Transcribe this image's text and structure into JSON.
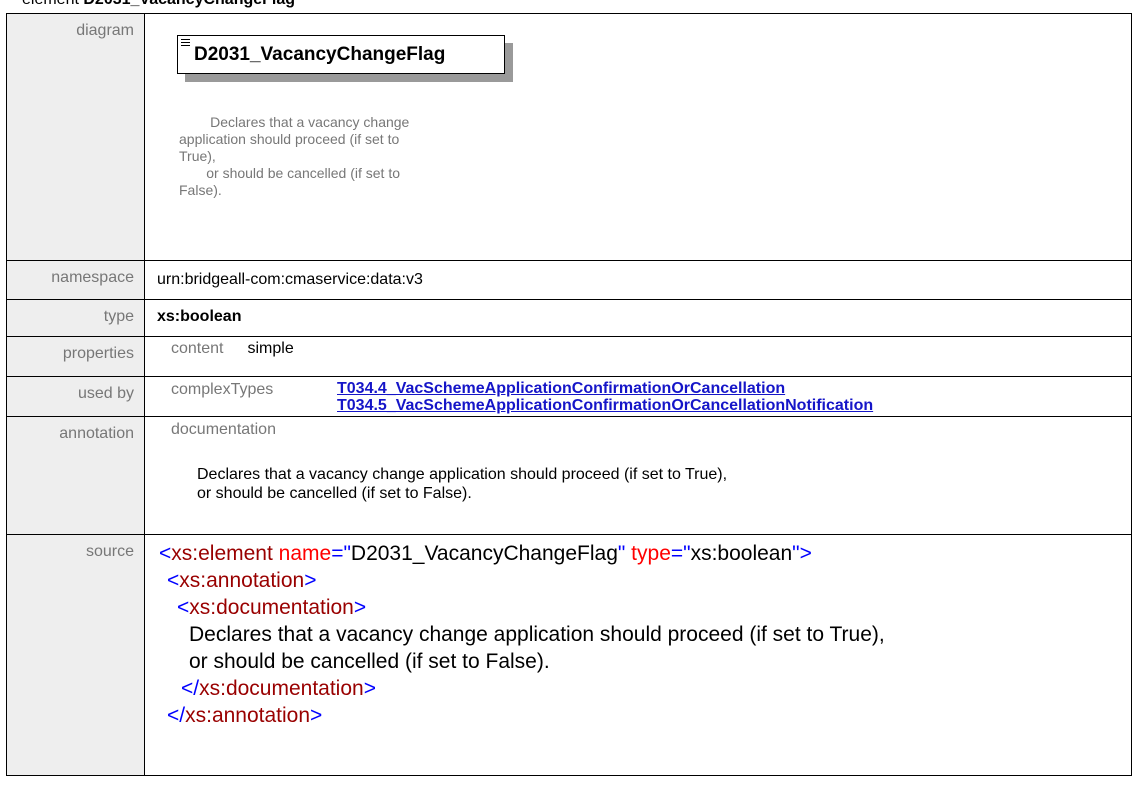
{
  "heading": {
    "prefix": "element ",
    "name": "D2031_VacancyChangeFlag"
  },
  "labels": {
    "diagram": "diagram",
    "namespace": "namespace",
    "type": "type",
    "properties": "properties",
    "used_by": "used by",
    "annotation": "annotation",
    "source": "source"
  },
  "diagram": {
    "element_name": "D2031_VacancyChangeFlag",
    "documentation": "        Declares that a vacancy change\napplication should proceed (if set to\nTrue),\n       or should be cancelled (if set to\nFalse)."
  },
  "namespace": "urn:bridgeall-com:cmaservice:data:v3",
  "type": "xs:boolean",
  "properties": {
    "key": "content",
    "value": "simple"
  },
  "used_by": {
    "kind": "complexTypes",
    "links": [
      "T034.4_VacSchemeApplicationConfirmationOrCancellation",
      "T034.5_VacSchemeApplicationConfirmationOrCancellationNotification"
    ]
  },
  "annotation": {
    "kind": "documentation",
    "text": "Declares that a vacancy change application should proceed (if set to True),\nor should be cancelled (if set to False)."
  },
  "source": {
    "l1_open": "<",
    "l1_tag": "xs:element",
    "l1_attr1": " name",
    "l1_eq1": "=\"",
    "l1_val1": "D2031_VacancyChangeFlag",
    "l1_q1": "\"",
    "l1_attr2": " type",
    "l1_eq2": "=\"",
    "l1_val2": "xs:boolean",
    "l1_close": "\">",
    "l2_open": "<",
    "l2_tag": "xs:annotation",
    "l2_close": ">",
    "l3_open": "<",
    "l3_tag": "xs:documentation",
    "l3_close": ">",
    "l4_text": "Declares that a vacancy change application should proceed (if set to True),",
    "l5_text": "or should be cancelled (if set to False).",
    "l6_open": "</",
    "l6_tag": "xs:documentation",
    "l6_close": ">",
    "l7_open": "</",
    "l7_tag": "xs:annotation",
    "l7_close": ">"
  }
}
